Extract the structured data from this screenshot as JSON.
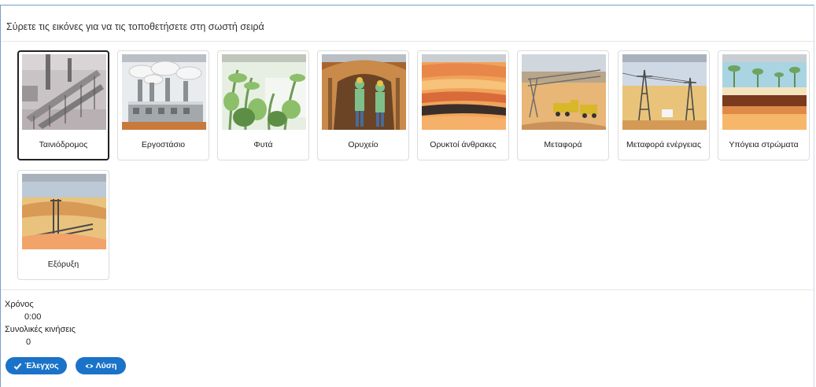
{
  "instruction": "Σύρετε τις εικόνες για να τις τοποθετήσετε στη σωστή σειρά",
  "cards": [
    {
      "label": "Ταινιόδρομος",
      "icon": "conveyor-belt-image",
      "selected": true
    },
    {
      "label": "Εργοστάσιο",
      "icon": "factory-image",
      "selected": false
    },
    {
      "label": "Φυτά",
      "icon": "plants-image",
      "selected": false
    },
    {
      "label": "Ορυχείο",
      "icon": "mine-image",
      "selected": false
    },
    {
      "label": "Ορυκτοί άνθρακες",
      "icon": "coal-layers-image",
      "selected": false
    },
    {
      "label": "Μεταφορά",
      "icon": "transport-image",
      "selected": false
    },
    {
      "label": "Μεταφορά ενέργειας",
      "icon": "power-lines-image",
      "selected": false
    },
    {
      "label": "Υπόγεια στρώματα",
      "icon": "underground-layers-image",
      "selected": false
    },
    {
      "label": "Εξόρυξη",
      "icon": "excavation-image",
      "selected": false
    }
  ],
  "stats": {
    "time_label": "Χρόνος",
    "time_value": "0:00",
    "moves_label": "Συνολικές κινήσεις",
    "moves_value": "0"
  },
  "buttons": {
    "check_label": "Έλεγχος",
    "check_icon": "checkmark-icon",
    "solution_label": "Λύση",
    "solution_icon": "eye-icon"
  },
  "colors": {
    "button": "#1a73c8",
    "frame_border": "#7a9cc6"
  }
}
